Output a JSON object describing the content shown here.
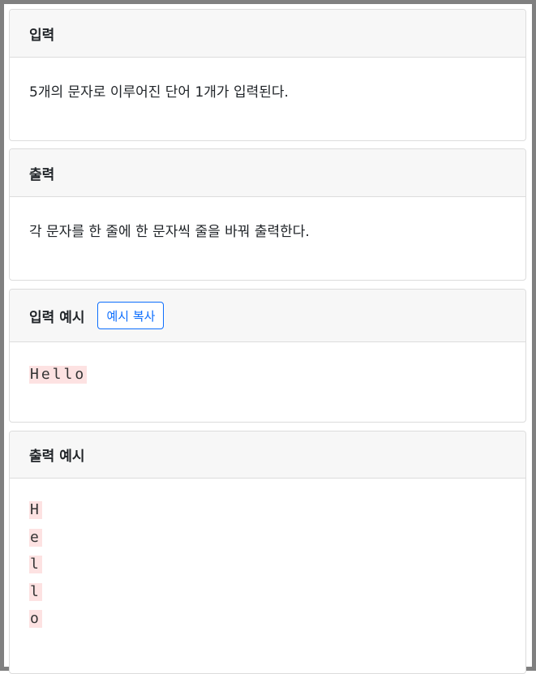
{
  "input_section": {
    "title": "입력",
    "description": "5개의 문자로 이루어진 단어 1개가 입력된다."
  },
  "output_section": {
    "title": "출력",
    "description": "각 문자를 한 줄에 한 문자씩 줄을 바꿔 출력한다."
  },
  "sample_input": {
    "title": "입력 예시",
    "copy_button_label": "예시 복사",
    "lines": [
      "Hello"
    ]
  },
  "sample_output": {
    "title": "출력 예시",
    "lines": [
      "H",
      "e",
      "l",
      "l",
      "o"
    ]
  }
}
